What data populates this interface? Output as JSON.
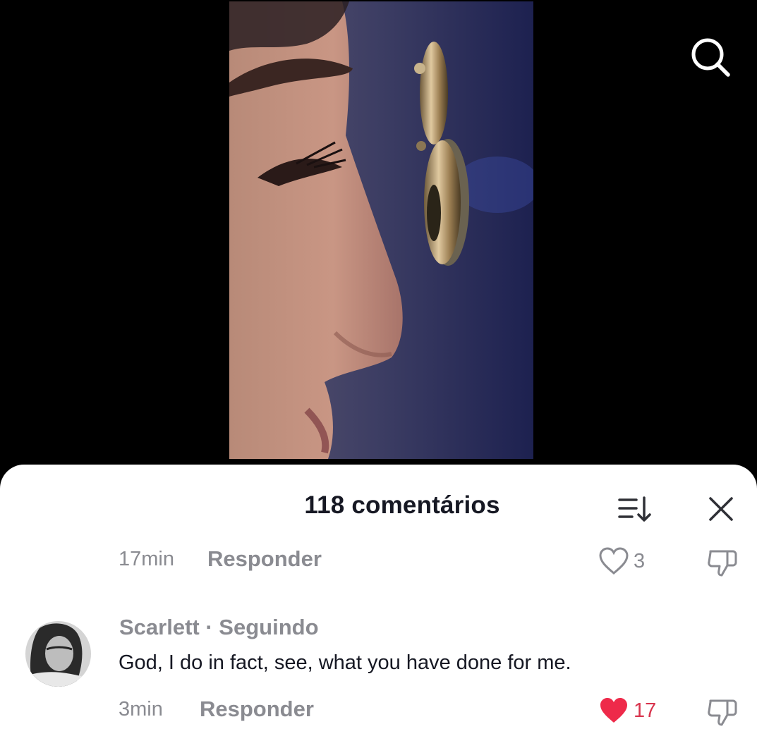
{
  "video": {
    "description_icon": "video-thumbnail-eye-peephole"
  },
  "header": {
    "search_icon": "search-icon"
  },
  "comments_sheet": {
    "title": "118 comentários",
    "sort_icon": "sort-icon",
    "close_icon": "close-icon",
    "comments": [
      {
        "time": "17min",
        "reply_label": "Responder",
        "likes": "3",
        "liked": false
      },
      {
        "username": "Scarlett",
        "separator": " · ",
        "relation": "Seguindo",
        "text": "God, I do in fact, see, what you have done for me.",
        "time": "3min",
        "reply_label": "Responder",
        "likes": "17",
        "liked": true
      }
    ]
  },
  "colors": {
    "background": "#000000",
    "sheet": "#ffffff",
    "primary_text": "#161823",
    "secondary_text": "#8a8b91",
    "like_active": "#d8344d"
  }
}
